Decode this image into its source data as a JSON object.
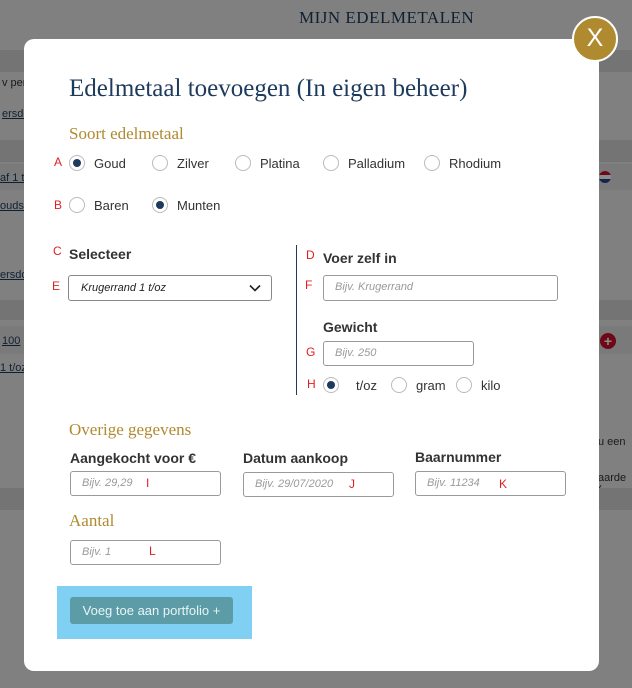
{
  "background": {
    "title": "MIJN EDELMETALEN",
    "snippets": [
      "v per",
      "ersdo",
      "af 1 t",
      "oudst",
      "ersdo",
      "100",
      "1 t/oz",
      "u een",
      "aarde ("
    ]
  },
  "modal": {
    "title": "Edelmetaal toevoegen (In eigen beheer)",
    "close_label": "X",
    "soort_title": "Soort edelmetaal",
    "metals": [
      {
        "label": "Goud",
        "checked": true
      },
      {
        "label": "Zilver",
        "checked": false
      },
      {
        "label": "Platina",
        "checked": false
      },
      {
        "label": "Palladium",
        "checked": false
      },
      {
        "label": "Rhodium",
        "checked": false
      }
    ],
    "forms": [
      {
        "label": "Baren",
        "checked": false
      },
      {
        "label": "Munten",
        "checked": true
      }
    ],
    "selecteer": {
      "label": "Selecteer",
      "value": "Krugerrand 1 t/oz"
    },
    "voer_zelf_in": {
      "label": "Voer zelf in",
      "placeholder": "Bijv. Krugerrand"
    },
    "gewicht": {
      "label": "Gewicht",
      "placeholder": "Bijv. 250"
    },
    "units": [
      {
        "label": "t/oz",
        "checked": true
      },
      {
        "label": "gram",
        "checked": false
      },
      {
        "label": "kilo",
        "checked": false
      }
    ],
    "overige_title": "Overige gegevens",
    "aangekocht": {
      "label": "Aangekocht voor €",
      "placeholder": "Bijv. 29,29"
    },
    "datum": {
      "label": "Datum aankoop",
      "placeholder": "Bijv. 29/07/2020"
    },
    "baarnummer": {
      "label": "Baarnummer",
      "placeholder": "Bijv. 11234"
    },
    "aantal_title": "Aantal",
    "aantal": {
      "placeholder": "Bijv. 1"
    },
    "submit_label": "Voeg toe aan portfolio +"
  },
  "markers": {
    "A": "A",
    "B": "B",
    "C": "C",
    "D": "D",
    "E": "E",
    "F": "F",
    "G": "G",
    "H": "H",
    "I": "I",
    "J": "J",
    "K": "K",
    "L": "L"
  },
  "colors": {
    "navy": "#1d3b5c",
    "gold": "#b08a2e",
    "marker_red": "#e02020",
    "submit_button": "#5b9ca6",
    "submit_highlight": "#7fd0f2"
  }
}
